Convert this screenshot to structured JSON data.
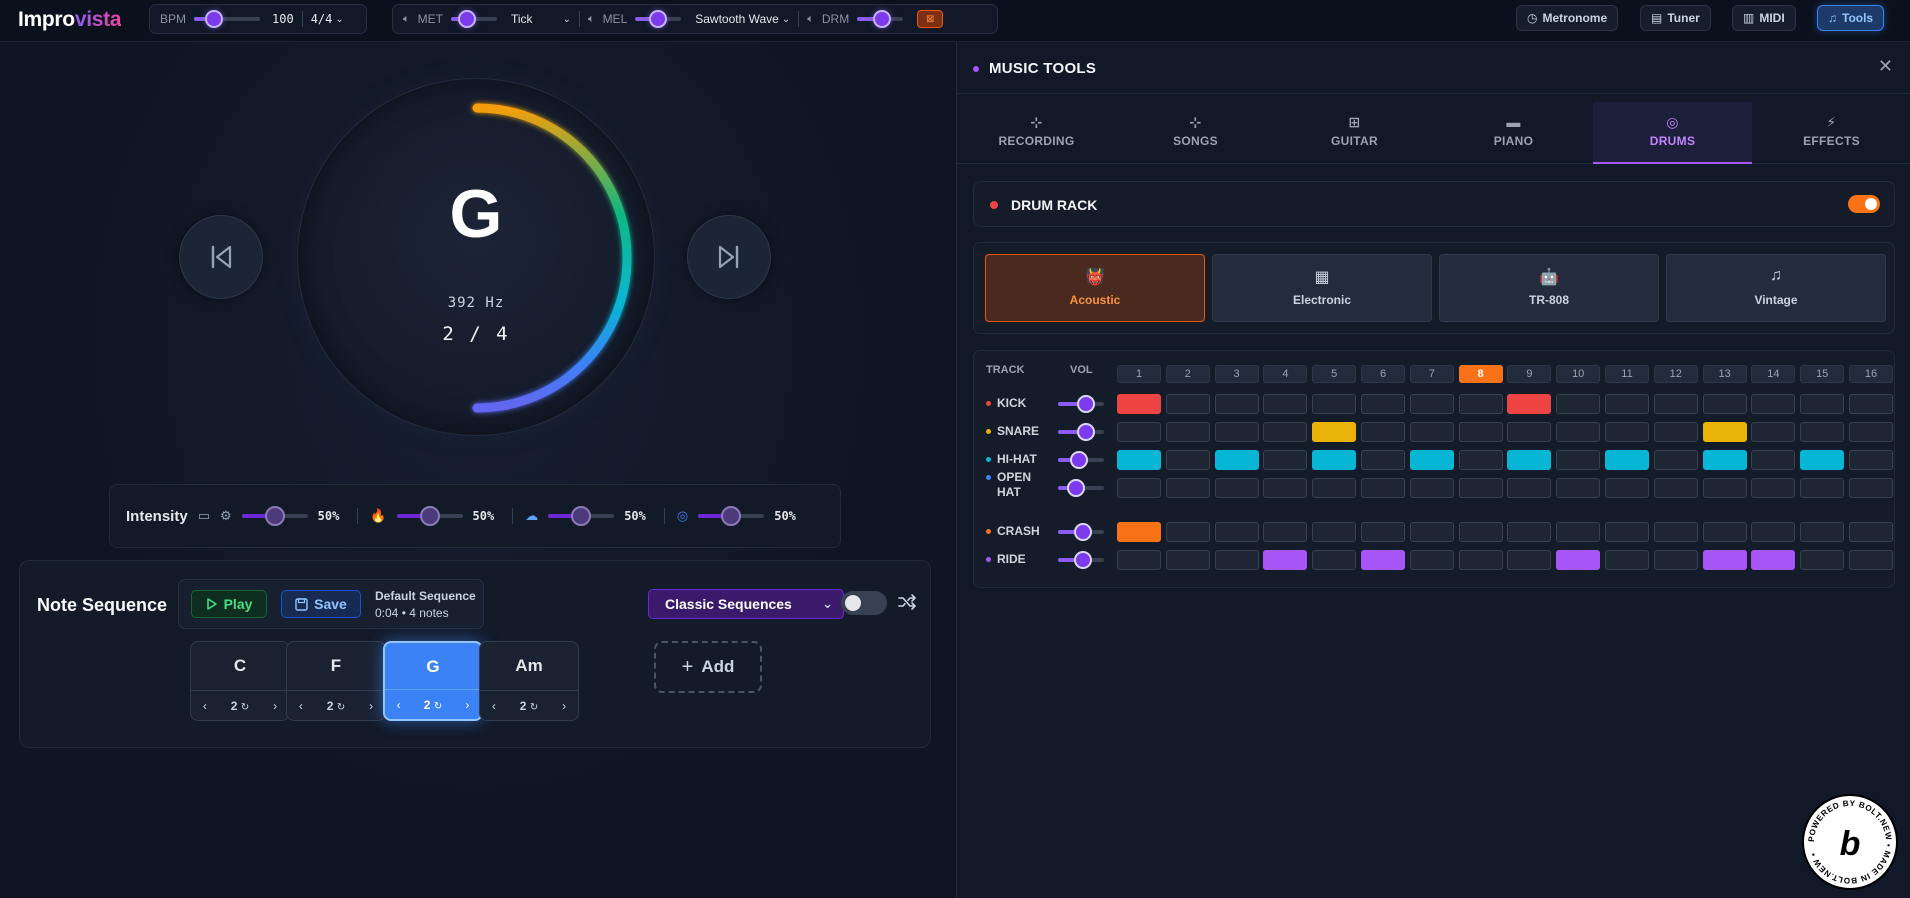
{
  "app": {
    "logo_a": "Impro",
    "logo_b": "vista"
  },
  "topbar": {
    "bpm_label": "BPM",
    "bpm_value": "100",
    "bpm_level": 0.3,
    "time_sig": "4/4",
    "met_label": "MET",
    "met_level": 0.35,
    "met_sound": "Tick",
    "mel_label": "MEL",
    "mel_level": 0.5,
    "mel_sound": "Sawtooth Wave",
    "drm_label": "DRM",
    "drm_level": 0.55,
    "drm_icon": "⊠",
    "nav": [
      {
        "label": "Metronome",
        "icon": "clock-icon",
        "glyph": "◷"
      },
      {
        "label": "Tuner",
        "icon": "tuner-icon",
        "glyph": "▤"
      },
      {
        "label": "MIDI",
        "icon": "keyboard-icon",
        "glyph": "▥"
      },
      {
        "label": "Tools",
        "icon": "music-note-icon",
        "glyph": "♫"
      }
    ]
  },
  "player": {
    "note": "G",
    "frequency": "392 Hz",
    "position": "2 / 4",
    "progress": 0.5
  },
  "intensity": {
    "label": "Intensity",
    "controls": [
      {
        "icon": "camera-icon",
        "glyph": "▭",
        "value": "50%",
        "level": 0.5
      },
      {
        "icon": "fire-icon",
        "glyph": "🔥",
        "value": "50%",
        "level": 0.5
      },
      {
        "icon": "storm-icon",
        "glyph": "☁",
        "value": "50%",
        "level": 0.5
      },
      {
        "icon": "spiral-icon",
        "glyph": "◎",
        "value": "50%",
        "level": 0.5
      }
    ]
  },
  "sequence": {
    "title": "Note Sequence",
    "play_label": "Play",
    "save_label": "Save",
    "name": "Default Sequence",
    "meta": "0:04 • 4 notes",
    "preset": "Classic Sequences",
    "add_label": "Add",
    "notes": [
      {
        "name": "C",
        "count": "2"
      },
      {
        "name": "F",
        "count": "2"
      },
      {
        "name": "G",
        "count": "2"
      },
      {
        "name": "Am",
        "count": "2"
      }
    ],
    "active_index": 2
  },
  "tools": {
    "title": "MUSIC TOOLS",
    "tabs": [
      {
        "label": "RECORDING",
        "glyph": "⊹",
        "icon": "recording-icon"
      },
      {
        "label": "SONGS",
        "glyph": "⊹",
        "icon": "songs-icon"
      },
      {
        "label": "GUITAR",
        "glyph": "⊞",
        "icon": "guitar-icon"
      },
      {
        "label": "PIANO",
        "glyph": "▬",
        "icon": "piano-icon"
      },
      {
        "label": "DRUMS",
        "glyph": "◎",
        "icon": "drums-icon"
      },
      {
        "label": "EFFECTS",
        "glyph": "⚡",
        "icon": "effects-icon"
      }
    ],
    "active_tab": 4
  },
  "drum_rack": {
    "title": "DRUM RACK",
    "kits": [
      {
        "label": "Acoustic",
        "glyph": "👹",
        "icon": "acoustic-kit-icon"
      },
      {
        "label": "Electronic",
        "glyph": "▦",
        "icon": "electronic-kit-icon"
      },
      {
        "label": "TR-808",
        "glyph": "🤖",
        "icon": "tr808-kit-icon"
      },
      {
        "label": "Vintage",
        "glyph": "♫",
        "icon": "vintage-kit-icon"
      }
    ],
    "active_kit": 0,
    "track_header": "TRACK",
    "vol_header": "VOL",
    "steps": [
      "1",
      "2",
      "3",
      "4",
      "5",
      "6",
      "7",
      "8",
      "9",
      "10",
      "11",
      "12",
      "13",
      "14",
      "15",
      "16"
    ],
    "current_step": 8,
    "tracks": [
      {
        "name": "KICK",
        "color": "#ef4444",
        "volume": 0.6,
        "pattern": [
          1,
          0,
          0,
          0,
          0,
          0,
          0,
          0,
          1,
          0,
          0,
          0,
          0,
          0,
          0,
          0
        ]
      },
      {
        "name": "SNARE",
        "color": "#eab308",
        "volume": 0.6,
        "pattern": [
          0,
          0,
          0,
          0,
          1,
          0,
          0,
          0,
          0,
          0,
          0,
          0,
          1,
          0,
          0,
          0
        ]
      },
      {
        "name": "HI-HAT",
        "color": "#06b6d4",
        "volume": 0.45,
        "pattern": [
          1,
          0,
          1,
          0,
          1,
          0,
          1,
          0,
          1,
          0,
          1,
          0,
          1,
          0,
          1,
          0
        ]
      },
      {
        "name": "OPEN HAT",
        "color": "#3b82f6",
        "volume": 0.4,
        "pattern": [
          0,
          0,
          0,
          0,
          0,
          0,
          0,
          0,
          0,
          0,
          0,
          0,
          0,
          0,
          0,
          0
        ]
      },
      {
        "name": "CRASH",
        "color": "#f97316",
        "volume": 0.55,
        "pattern": [
          1,
          0,
          0,
          0,
          0,
          0,
          0,
          0,
          0,
          0,
          0,
          0,
          0,
          0,
          0,
          0
        ]
      },
      {
        "name": "RIDE",
        "color": "#a855f7",
        "volume": 0.55,
        "pattern": [
          0,
          0,
          0,
          1,
          0,
          1,
          0,
          0,
          0,
          1,
          0,
          0,
          1,
          1,
          0,
          0
        ]
      }
    ]
  },
  "badge": {
    "ring_text": "POWERED BY BOLT.NEW • MADE IN BOLT.NEW •",
    "letter": "b"
  }
}
